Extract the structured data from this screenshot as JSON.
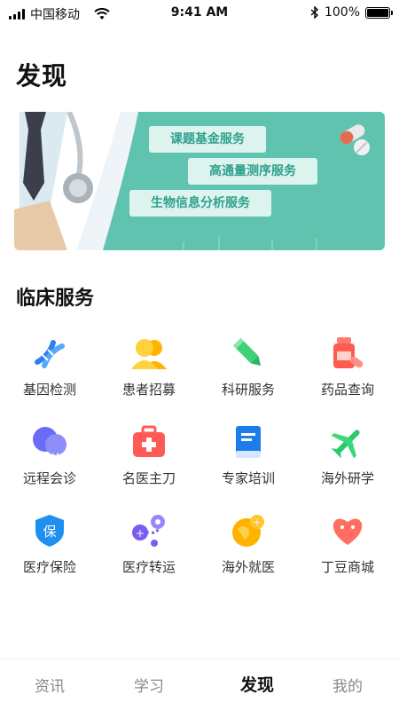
{
  "status_bar": {
    "carrier": "中国移动",
    "time": "9:41 AM",
    "battery": "100%"
  },
  "page": {
    "title": "发现"
  },
  "banner": {
    "items": [
      "课题基金服务",
      "高通量测序服务",
      "生物信息分析服务"
    ]
  },
  "clinical": {
    "title": "临床服务",
    "items": [
      {
        "label": "基因检测",
        "icon": "dna-icon"
      },
      {
        "label": "患者招募",
        "icon": "people-icon"
      },
      {
        "label": "科研服务",
        "icon": "pencil-icon"
      },
      {
        "label": "药品查询",
        "icon": "medicine-bottle-icon"
      },
      {
        "label": "远程会诊",
        "icon": "remote-consult-icon"
      },
      {
        "label": "名医主刀",
        "icon": "medical-kit-icon"
      },
      {
        "label": "专家培训",
        "icon": "book-icon"
      },
      {
        "label": "海外研学",
        "icon": "airplane-icon"
      },
      {
        "label": "医疗保险",
        "icon": "insurance-shield-icon"
      },
      {
        "label": "医疗转运",
        "icon": "transfer-route-icon"
      },
      {
        "label": "海外就医",
        "icon": "globe-medical-icon"
      },
      {
        "label": "丁豆商城",
        "icon": "heart-shop-icon"
      }
    ]
  },
  "tabs": [
    {
      "label": "资讯",
      "active": false
    },
    {
      "label": "学习",
      "active": false
    },
    {
      "label": "发现",
      "active": true
    },
    {
      "label": "我的",
      "active": false
    }
  ],
  "colors": {
    "accent": "#4a8ef5",
    "banner": "#5fc3b0"
  }
}
